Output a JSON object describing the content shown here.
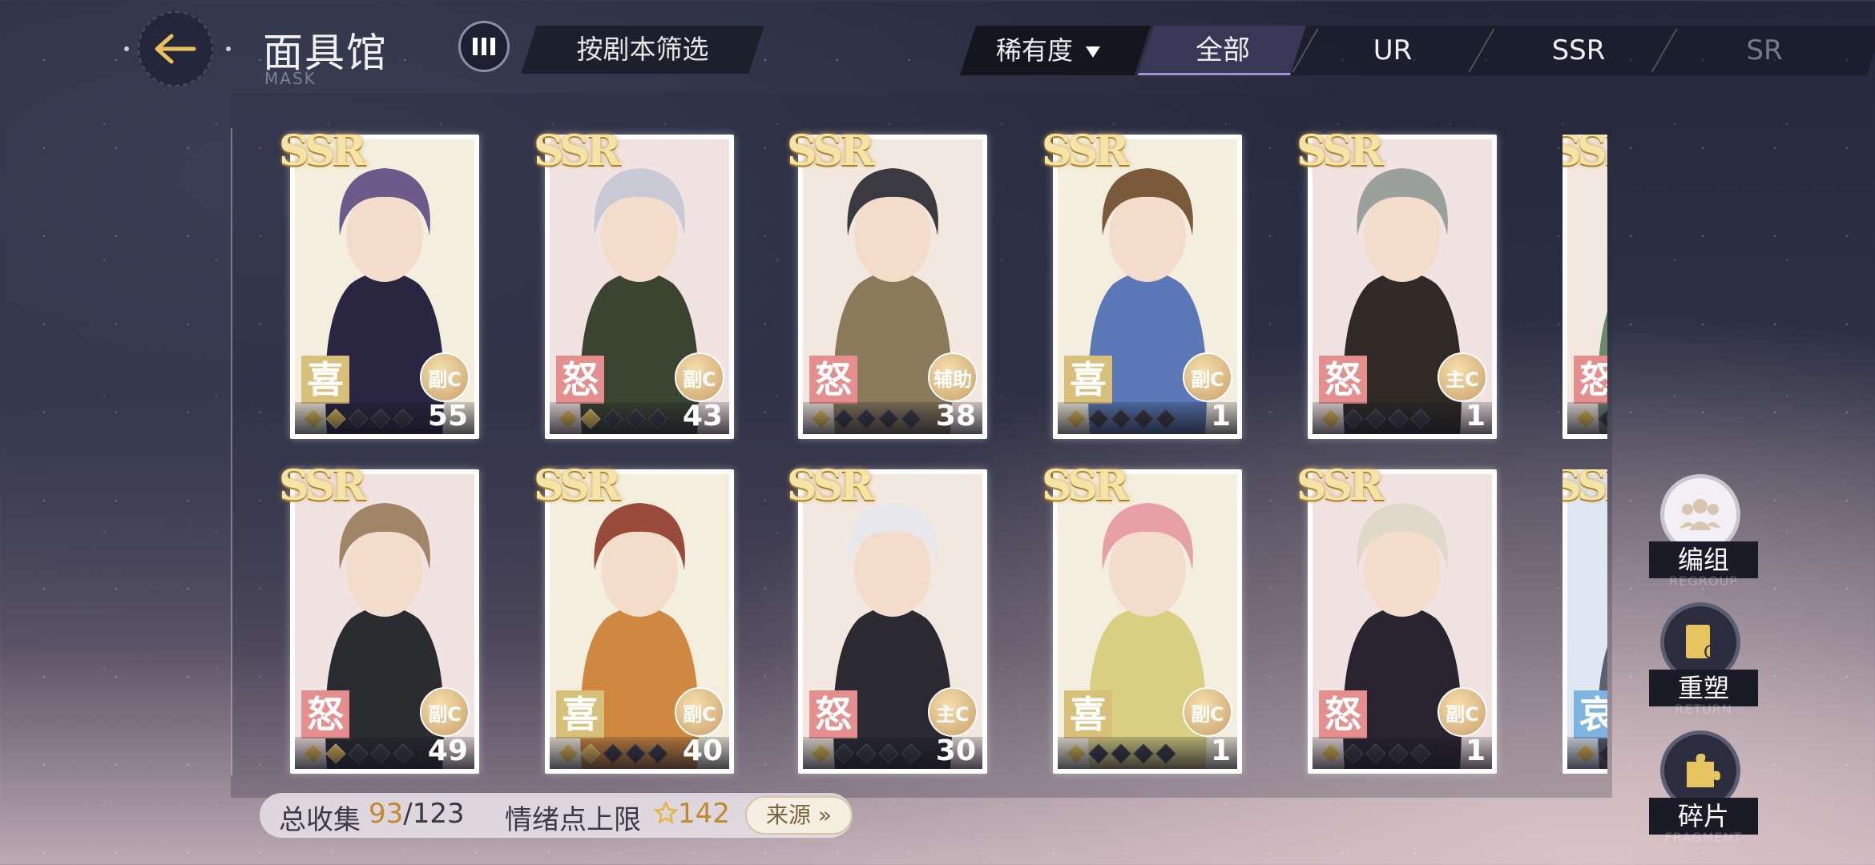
{
  "header": {
    "title": "面具馆",
    "subtitle": "MASK",
    "script_filter_label": "按剧本筛选",
    "rarity_dropdown_label": "稀有度",
    "tabs": [
      "全部",
      "UR",
      "SSR",
      "SR"
    ],
    "active_tab": "全部"
  },
  "cards": [
    {
      "rarity": "SSR",
      "emotion": "喜",
      "emotion_type": "joy",
      "role": "副C",
      "stars": 2,
      "count": "55"
    },
    {
      "rarity": "SSR",
      "emotion": "怒",
      "emotion_type": "anger",
      "role": "副C",
      "stars": 2,
      "count": "43"
    },
    {
      "rarity": "SSR",
      "emotion": "怒",
      "emotion_type": "anger",
      "role": "辅助",
      "stars": 1,
      "count": "38"
    },
    {
      "rarity": "SSR",
      "emotion": "喜",
      "emotion_type": "joy",
      "role": "副C",
      "stars": 1,
      "count": "1"
    },
    {
      "rarity": "SSR",
      "emotion": "怒",
      "emotion_type": "anger",
      "role": "主C",
      "stars": 1,
      "count": "1"
    },
    {
      "rarity": "SSR",
      "emotion": "怒",
      "emotion_type": "anger",
      "role": "",
      "stars": 1,
      "count": ""
    },
    {
      "rarity": "SSR",
      "emotion": "怒",
      "emotion_type": "anger",
      "role": "副C",
      "stars": 2,
      "count": "49"
    },
    {
      "rarity": "SSR",
      "emotion": "喜",
      "emotion_type": "joy",
      "role": "副C",
      "stars": 2,
      "count": "40"
    },
    {
      "rarity": "SSR",
      "emotion": "怒",
      "emotion_type": "anger",
      "role": "主C",
      "stars": 1,
      "count": "30"
    },
    {
      "rarity": "SSR",
      "emotion": "喜",
      "emotion_type": "joy",
      "role": "副C",
      "stars": 1,
      "count": "1"
    },
    {
      "rarity": "SSR",
      "emotion": "怒",
      "emotion_type": "anger",
      "role": "副C",
      "stars": 1,
      "count": "1"
    },
    {
      "rarity": "SSR",
      "emotion": "哀",
      "emotion_type": "sad",
      "role": "",
      "stars": 1,
      "count": ""
    }
  ],
  "footer": {
    "collection_label": "总收集",
    "collection_owned": "93",
    "collection_total": "/123",
    "mood_label": "情绪点上限",
    "mood_value": "142",
    "source_button": "来源"
  },
  "side": {
    "team_label": "编组",
    "team_sub": "REGROUP",
    "reshape_label": "重塑",
    "reshape_sub": "RETURN",
    "fragment_label": "碎片",
    "fragment_sub": "FRAGMENT"
  },
  "colors": {
    "gold": "#f0c85a",
    "joy": "#d8c07a",
    "anger": "#e58e8e",
    "sad": "#7fb4e0",
    "accent_tab": "#a58fd8"
  }
}
